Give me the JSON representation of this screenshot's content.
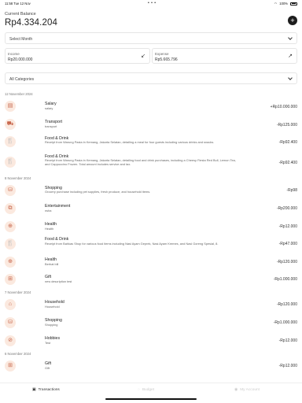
{
  "status_bar": {
    "time": "11:58",
    "date": "Tue 12 Nov",
    "battery": "100%"
  },
  "balance": {
    "label": "Current Balance",
    "value": "Rp4.334.204"
  },
  "month_select": {
    "value": "Select Month"
  },
  "income": {
    "label": "Income",
    "value": "Rp20.000.000"
  },
  "expense": {
    "label": "Expense",
    "value": "Rp5.665.796"
  },
  "category_select": {
    "value": "All Categories"
  },
  "date_headers": [
    "12 November 2024",
    "8 November 2024",
    "7 November 2024",
    "6 November 2024"
  ],
  "transactions": [
    {
      "title": "Salary",
      "desc": "salary",
      "amount": "+Rp10.000.000",
      "icon": "salary-icon"
    },
    {
      "title": "Transport",
      "desc": "transport",
      "amount": "-Rp125.000",
      "icon": "car-icon"
    },
    {
      "title": "Food & Drink",
      "desc": "Receipt from Warung Pasta in Kemang, Jakarta Selatan, detailing a meal for four guests including various drinks and snacks.",
      "amount": "-Rp92.400",
      "icon": "fork-knife-icon"
    },
    {
      "title": "Food & Drink",
      "desc": "Receipt from Warung Pasta in Kemang, Jakarta Selatan, detailing food and drink purchases, including a Cheesy Fiesta Red Bull, Lemon Tea, and Cappuccino Frozen. Total amount includes service and tax.",
      "amount": "-Rp92.400",
      "icon": "fork-knife-icon"
    },
    {
      "title": "Shopping",
      "desc": "Grocery purchase including pet supplies, fresh produce, and household items.",
      "amount": "-Rp98",
      "icon": "shopping-bag-icon"
    },
    {
      "title": "Entertainment",
      "desc": "nsha",
      "amount": "-Rp200.000",
      "icon": "entertainment-icon"
    },
    {
      "title": "Health",
      "desc": "Health",
      "amount": "-Rp12.000",
      "icon": "health-icon"
    },
    {
      "title": "Food & Drink",
      "desc": "Receipt from Bahkas Shop for various food items including Nasi Ayam Geprek, Nasi Ayam Kremes, and Nasi Goreng Spesial, 8.",
      "amount": "-Rp47.000",
      "icon": "fork-knife-icon"
    },
    {
      "title": "Health",
      "desc": "Berhat bill",
      "amount": "-Rp120.000",
      "icon": "health-icon"
    },
    {
      "title": "Gift",
      "desc": "new description test",
      "amount": "-Rp1.000.000",
      "icon": "gift-icon"
    },
    {
      "title": "Household",
      "desc": "Household",
      "amount": "-Rp120.000",
      "icon": "home-icon"
    },
    {
      "title": "Shopping",
      "desc": "Shopping",
      "amount": "-Rp1.000.000",
      "icon": "shopping-bag-icon"
    },
    {
      "title": "Hobbies",
      "desc": "Test",
      "amount": "-Rp12.000",
      "icon": "hobbies-icon"
    },
    {
      "title": "Gift",
      "desc": "Gift",
      "amount": "-Rp12.000",
      "icon": "gift-icon"
    }
  ],
  "tabs": [
    {
      "label": "Transactions",
      "icon": "transactions-icon",
      "active": true
    },
    {
      "label": "Budget",
      "icon": "budget-icon",
      "active": false
    },
    {
      "label": "My Account",
      "icon": "account-icon",
      "active": false
    }
  ],
  "colors": {
    "accent_bg": "#fbe9df",
    "accent_fg": "#c7654a",
    "button_dark": "#1d1d1d"
  }
}
